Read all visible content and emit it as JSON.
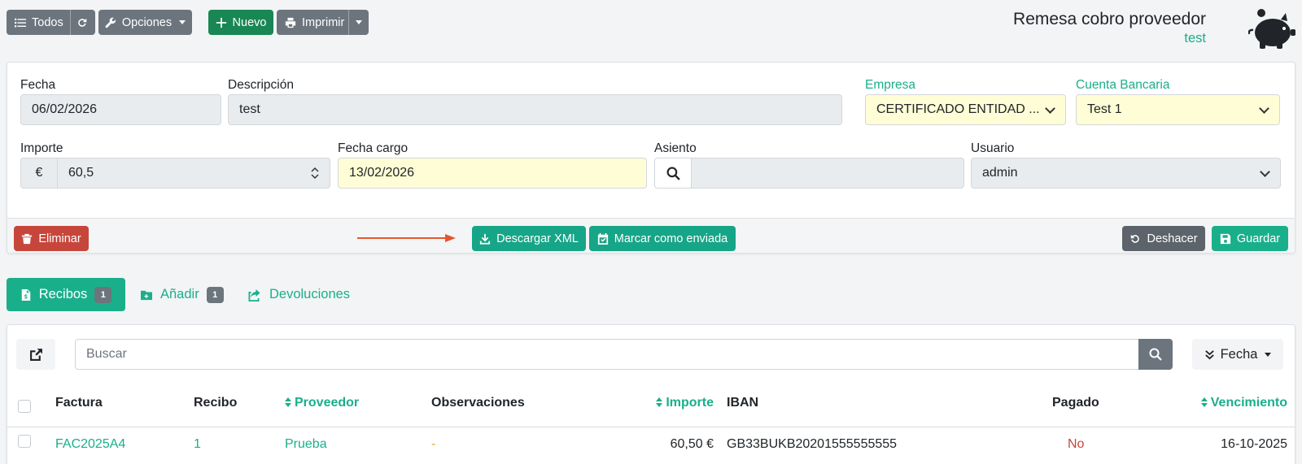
{
  "toolbar": {
    "all_label": "Todos",
    "options_label": "Opciones",
    "new_label": "Nuevo",
    "print_label": "Imprimir"
  },
  "header": {
    "title": "Remesa cobro proveedor",
    "subtitle": "test"
  },
  "form": {
    "fecha_label": "Fecha",
    "fecha_value": "06/02/2026",
    "descripcion_label": "Descripción",
    "descripcion_value": "test",
    "empresa_label": "Empresa",
    "empresa_value": "CERTIFICADO ENTIDAD ...",
    "cuenta_label": "Cuenta Bancaria",
    "cuenta_value": "Test 1",
    "importe_label": "Importe",
    "importe_currency": "€",
    "importe_value": "60,5",
    "fecha_cargo_label": "Fecha cargo",
    "fecha_cargo_value": "13/02/2026",
    "asiento_label": "Asiento",
    "asiento_value": "",
    "usuario_label": "Usuario",
    "usuario_value": "admin"
  },
  "actions": {
    "delete_label": "Eliminar",
    "download_xml_label": "Descargar XML",
    "mark_sent_label": "Marcar como enviada",
    "undo_label": "Deshacer",
    "save_label": "Guardar"
  },
  "tabs": [
    {
      "label": "Recibos",
      "count": "1",
      "active": true
    },
    {
      "label": "Añadir",
      "count": "1",
      "active": false
    },
    {
      "label": "Devoluciones",
      "count": null,
      "active": false
    }
  ],
  "list": {
    "search_placeholder": "Buscar",
    "sort_label": "Fecha",
    "columns": [
      "Factura",
      "Recibo",
      "Proveedor",
      "Observaciones",
      "Importe",
      "IBAN",
      "Pagado",
      "Vencimiento"
    ],
    "rows": [
      {
        "factura": "FAC2025A4",
        "recibo": "1",
        "proveedor": "Prueba",
        "observaciones": "-",
        "importe": "60,50 €",
        "iban": "GB33BUKB20201555555555",
        "pagado": "No",
        "vencimiento": "16-10-2025"
      }
    ]
  },
  "colors": {
    "accent": "#1aaf8b",
    "success": "#198754",
    "danger": "#c7463c",
    "secondary": "#6c757d",
    "annotation_arrow": "#e4572e"
  }
}
